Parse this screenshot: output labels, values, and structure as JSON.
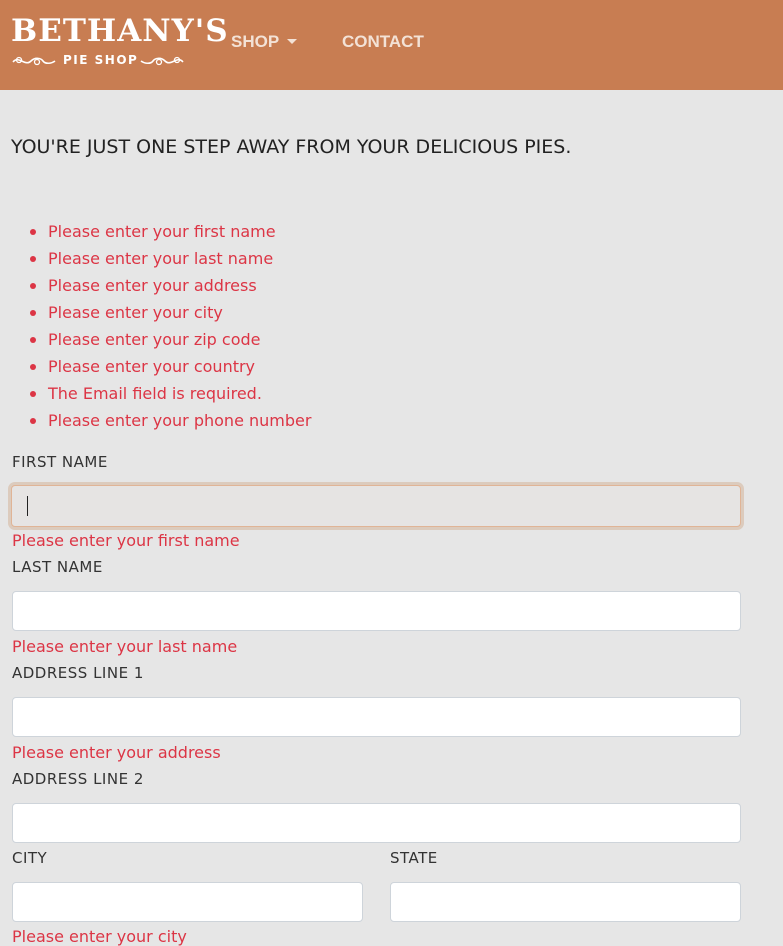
{
  "header": {
    "logo_title": "BETHANY'S",
    "logo_subtitle": "PIE SHOP",
    "nav": {
      "shop_label": "SHOP",
      "contact_label": "CONTACT"
    },
    "bg_color": "#c87d52"
  },
  "main": {
    "headline": "YOU'RE JUST ONE STEP AWAY FROM YOUR DELICIOUS PIES.",
    "errors": [
      "Please enter your first name",
      "Please enter your last name",
      "Please enter your address",
      "Please enter your city",
      "Please enter your zip code",
      "Please enter your country",
      "The Email field is required.",
      "Please enter your phone number"
    ]
  },
  "form": {
    "first_name": {
      "label": "FIRST NAME",
      "value": "",
      "error": "Please enter your first name"
    },
    "last_name": {
      "label": "LAST NAME",
      "value": "",
      "error": "Please enter your last name"
    },
    "address1": {
      "label": "ADDRESS LINE 1",
      "value": "",
      "error": "Please enter your address"
    },
    "address2": {
      "label": "ADDRESS LINE 2",
      "value": ""
    },
    "city": {
      "label": "CITY",
      "value": "",
      "error": "Please enter your city"
    },
    "state": {
      "label": "STATE",
      "value": ""
    }
  },
  "colors": {
    "error": "#dc3545",
    "page_bg": "#e6e6e6"
  }
}
